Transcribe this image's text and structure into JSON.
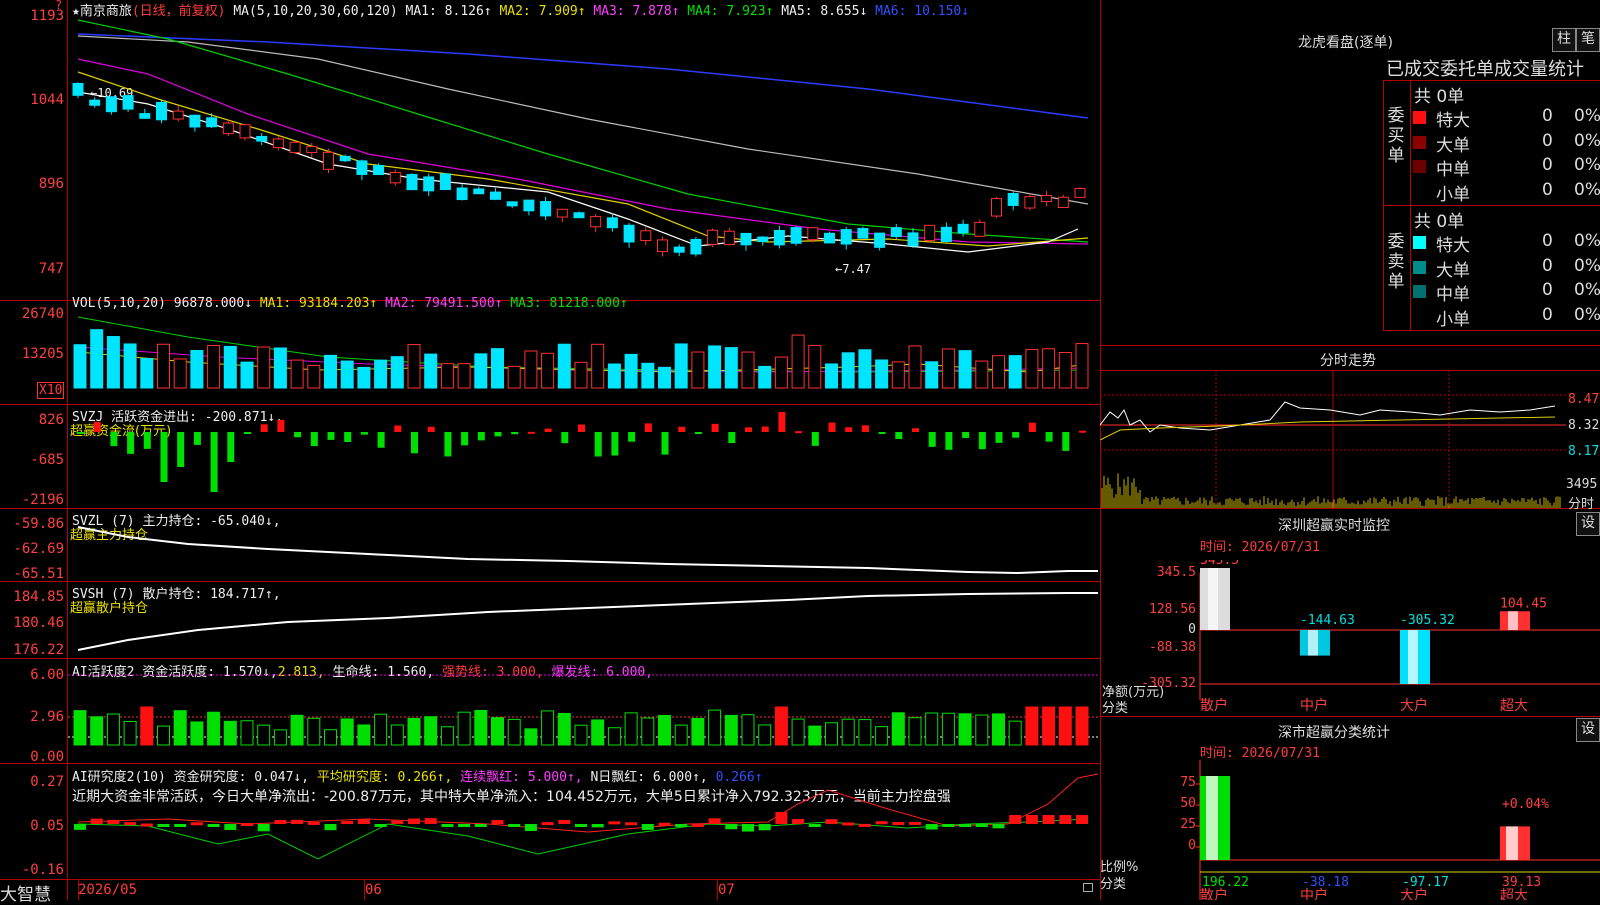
{
  "colors": {
    "up": "#ff3030",
    "down": "#00e5ff",
    "grid": "#b40000",
    "bg": "#000000"
  },
  "main": {
    "star": "★",
    "stock_name": "南京商旅",
    "period": "(日线，前复权)",
    "ma_params": "MA(5,10,20,30,60,120)",
    "ma1": "MA1: 8.126↑",
    "ma2": "MA2: 7.909↑",
    "ma3": "MA3: 7.878↑",
    "ma4": "MA4: 7.923↑",
    "ma5": "MA5: 8.655↓",
    "ma6": "MA6: 10.150↓",
    "y_ticks": [
      "1193",
      "1044",
      "896",
      "747"
    ],
    "high_mark": "←10.69",
    "low_mark": "←7.47",
    "corner": "?"
  },
  "vol": {
    "title": "VOL(5,10,20)",
    "value": "96878.000↓",
    "ma1": "MA1: 93184.203↑",
    "ma2": "MA2: 79491.500↑",
    "ma3": "MA3: 81218.000↑",
    "y_ticks": [
      "26740",
      "13205"
    ],
    "unit": "X10"
  },
  "svzj": {
    "title": "SVZJ  活跃资金进出: -200.871↓,",
    "sub": "超赢资金流(万元)",
    "y_ticks": [
      "826",
      "-685",
      "-2196"
    ]
  },
  "svzl": {
    "title": "SVZL (7) 主力持仓: -65.040↓,",
    "sub": "超赢主力持仓",
    "y_ticks": [
      "-59.86",
      "-62.69",
      "-65.51"
    ]
  },
  "svsh": {
    "title": "SVSH (7) 散户持仓: 184.717↑,",
    "sub": "超赢散户持仓",
    "y_ticks": [
      "184.85",
      "180.46",
      "176.22"
    ]
  },
  "ai1": {
    "title": "AI活跃度2 资金活跃度: 1.570↓,",
    "v2": "2.813,",
    "life": "生命线: 1.560,",
    "strong": "强势线: 3.000,",
    "burst": "爆发线: 6.000,",
    "y_ticks": [
      "6.00",
      "2.96",
      "0.00"
    ]
  },
  "ai2": {
    "title": "AI研究度2(10) 资金研究度: 0.047↓,",
    "avg": "平均研究度: 0.266↑,",
    "cont": "连续飘红: 5.000↑,",
    "n": "N日飘红: 6.000↑,",
    "last": "0.266↑",
    "note": "近期大资金非常活跃，今日大单净流出：-200.87万元，其中特大单净流入：104.452万元，大单5日累计净入792.323万元，当前主力控盘强",
    "y_ticks": [
      "0.27",
      "0.05",
      "-0.16"
    ]
  },
  "footer": {
    "brand": "大智慧",
    "dates": [
      "2026/05",
      "06",
      "07"
    ]
  },
  "right": {
    "lhkp_title": "龙虎看盘(逐单)",
    "btn_pillar": "柱",
    "btn_pen": "笔",
    "stat_title": "已成交委托单成交量统计",
    "buy": {
      "group": "委买单",
      "total": "共 0单",
      "rows": [
        {
          "name": "特大",
          "n": "0",
          "p": "0%",
          "c": "#ff1010"
        },
        {
          "name": "大单",
          "n": "0",
          "p": "0%",
          "c": "#8b0000"
        },
        {
          "name": "中单",
          "n": "0",
          "p": "0%",
          "c": "#6a0000"
        },
        {
          "name": "小单",
          "n": "0",
          "p": "0%",
          "c": "#000000"
        }
      ]
    },
    "sell": {
      "group": "委卖单",
      "total": "共 0单",
      "rows": [
        {
          "name": "特大",
          "n": "0",
          "p": "0%",
          "c": "#00ffff"
        },
        {
          "name": "大单",
          "n": "0",
          "p": "0%",
          "c": "#008b8b"
        },
        {
          "name": "中单",
          "n": "0",
          "p": "0%",
          "c": "#007070"
        },
        {
          "name": "小单",
          "n": "0",
          "p": "0%",
          "c": "#000000"
        }
      ]
    },
    "intraday_title": "分时走势",
    "intraday_ticks": [
      "8.47",
      "8.32",
      "8.17",
      "3495",
      "分时"
    ],
    "monitor": {
      "title": "深圳超赢实时监控",
      "btn": "设",
      "time": "时间: 2026/07/31",
      "y_ticks": [
        "345.5",
        "128.56",
        "0",
        "-88.38",
        "-305.32"
      ],
      "ylabel": "净额(万元)",
      "xcat": "分类",
      "categories": [
        "散户",
        "中户",
        "大户",
        "超大"
      ],
      "values": [
        345.5,
        -144.63,
        -305.32,
        104.45
      ],
      "labels": [
        "345.5",
        "-144.63",
        "-305.32",
        "104.45"
      ]
    },
    "classify": {
      "title": "深市超赢分类统计",
      "btn": "设",
      "time": "时间: 2026/07/31",
      "y_ticks": [
        "75",
        "50",
        "25",
        "0"
      ],
      "ylabel": "比例%",
      "xcat": "分类",
      "categories": [
        "散户",
        "中户",
        "大户",
        "超大"
      ],
      "bar_values": [
        100,
        0,
        0,
        40
      ],
      "labels": [
        "196.22",
        "-38.18",
        "-97.17",
        "39.13"
      ],
      "pct": "+0.04%"
    }
  }
}
